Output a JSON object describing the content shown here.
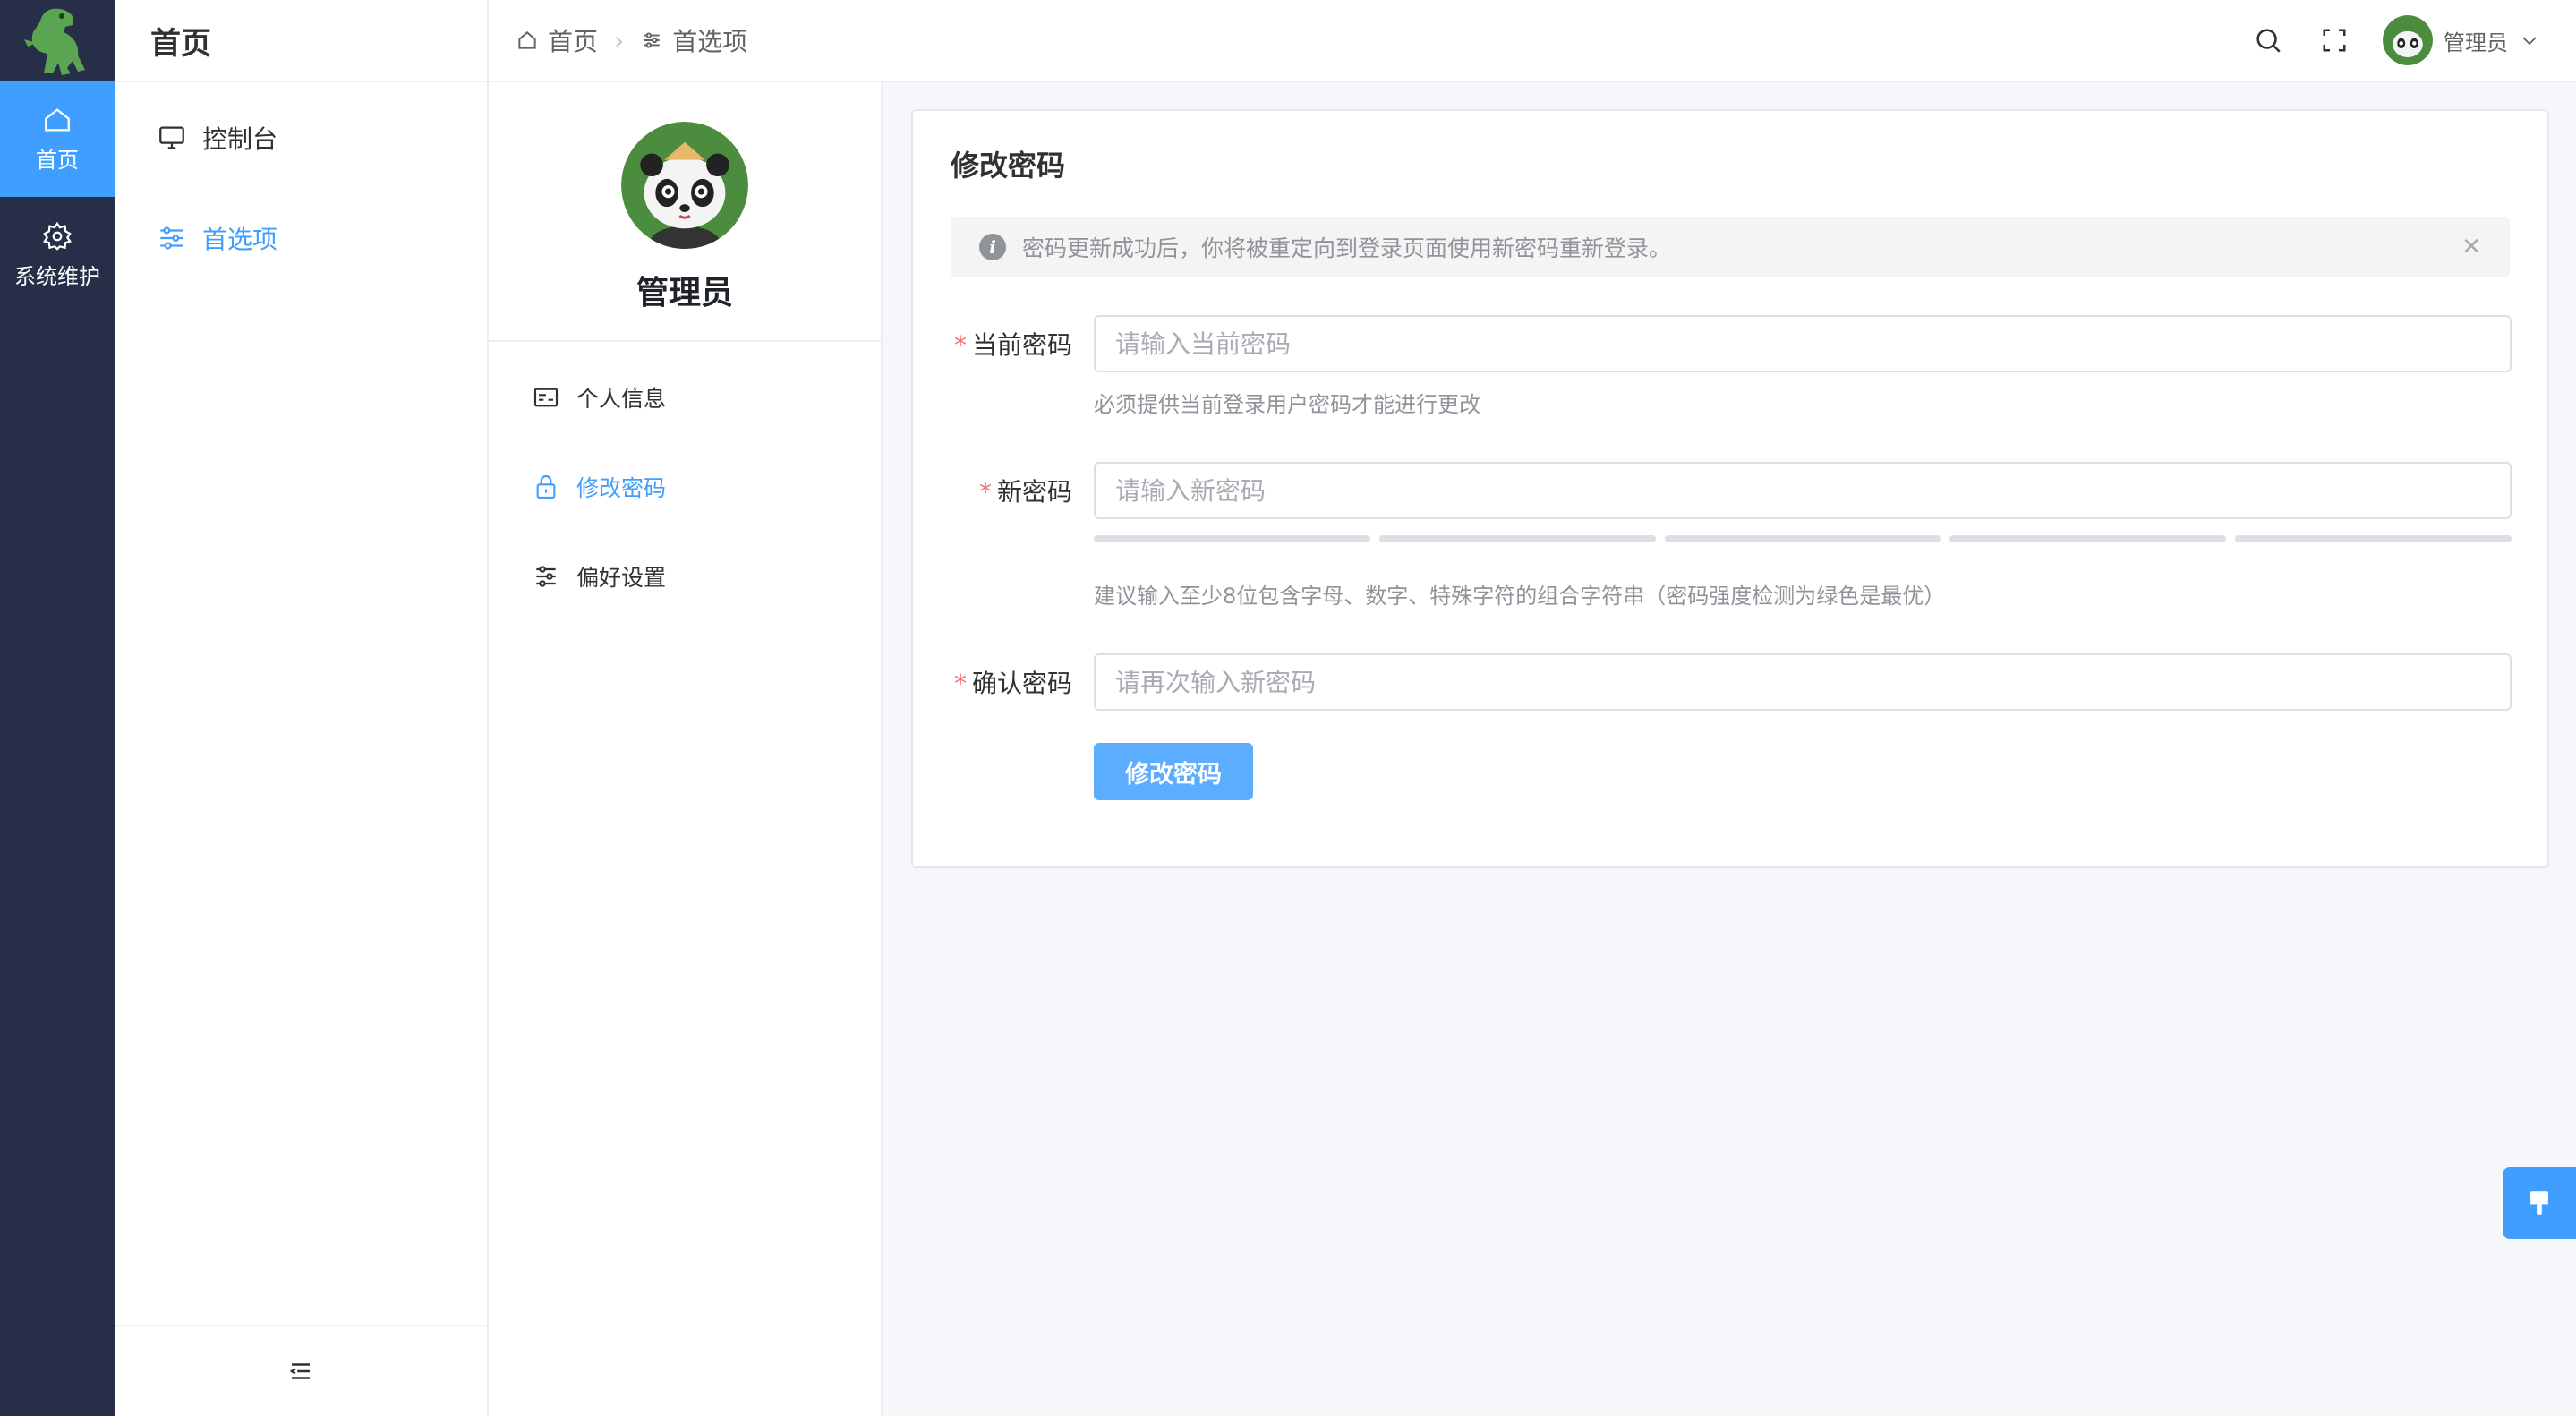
{
  "rail": {
    "items": [
      {
        "label": "首页",
        "icon": "home-icon"
      },
      {
        "label": "系统维护",
        "icon": "gear-icon"
      }
    ]
  },
  "submenu": {
    "title": "首页",
    "items": [
      {
        "label": "控制台",
        "icon": "monitor-icon"
      },
      {
        "label": "首选项",
        "icon": "sliders-icon"
      }
    ]
  },
  "breadcrumb": {
    "items": [
      "首页",
      "首选项"
    ]
  },
  "header": {
    "user_name": "管理员"
  },
  "profile": {
    "name": "管理员",
    "menu": [
      {
        "label": "个人信息",
        "icon": "id-card-icon"
      },
      {
        "label": "修改密码",
        "icon": "lock-icon"
      },
      {
        "label": "偏好设置",
        "icon": "sliders-icon"
      }
    ]
  },
  "form": {
    "title": "修改密码",
    "alert": "密码更新成功后，你将被重定向到登录页面使用新密码重新登录。",
    "current": {
      "label": "当前密码",
      "placeholder": "请输入当前密码",
      "hint": "必须提供当前登录用户密码才能进行更改"
    },
    "new": {
      "label": "新密码",
      "placeholder": "请输入新密码",
      "hint": "建议输入至少8位包含字母、数字、特殊字符的组合字符串（密码强度检测为绿色是最优）"
    },
    "confirm": {
      "label": "确认密码",
      "placeholder": "请再次输入新密码"
    },
    "submit_label": "修改密码",
    "required_mark": "*"
  },
  "colors": {
    "primary": "#409eff",
    "rail": "#272e47",
    "required": "#f56c6c"
  }
}
